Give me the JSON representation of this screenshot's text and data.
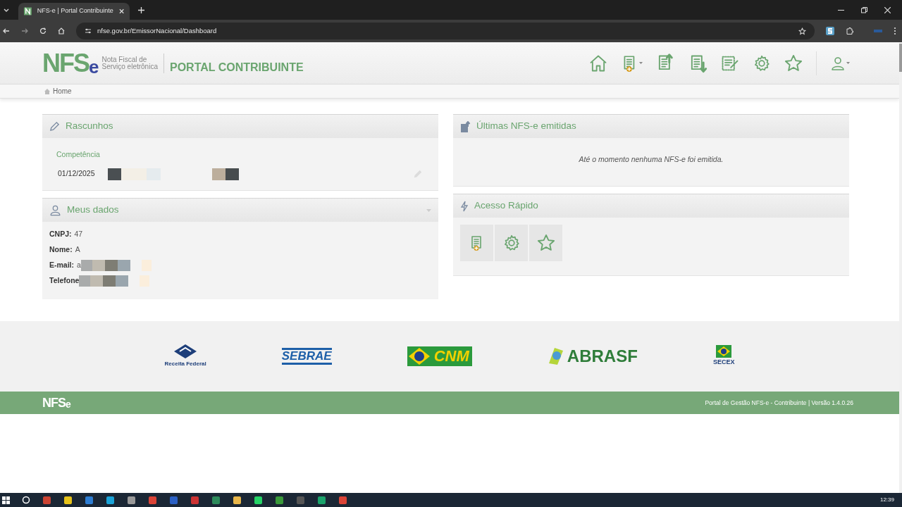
{
  "browser": {
    "tab_title": "NFS-e | Portal Contribuinte",
    "url": "nfse.gov.br/EmissorNacional/Dashboard"
  },
  "header": {
    "logo": {
      "mark": "NFS",
      "mark_e": "e",
      "line1": "Nota Fiscal de",
      "line2": "Serviço eletrônica"
    },
    "portal_title": "PORTAL CONTRIBUINTE"
  },
  "breadcrumb": [
    "Home"
  ],
  "drafts": {
    "title": "Rascunhos",
    "column_1": "Competência",
    "rows": [
      {
        "date": "01/12/2025"
      }
    ]
  },
  "my_data": {
    "title": "Meus dados",
    "fields": [
      {
        "label": "CNPJ:",
        "value": "47",
        "redacted": false
      },
      {
        "label": "Nome:",
        "value": "A",
        "redacted": false
      },
      {
        "label": "E-mail:",
        "value": "a",
        "redacted": true
      },
      {
        "label": "Telefone",
        "redacted": true
      }
    ]
  },
  "latest": {
    "title": "Últimas NFS-e emitidas",
    "message": "Até o momento nenhuma NFS-e foi emitida."
  },
  "quick_access": {
    "title": "Acesso Rápido"
  },
  "partners": [
    {
      "kind": "receita",
      "text": "Receita Federal"
    },
    {
      "kind": "sebrae",
      "text": "SEBRAE"
    },
    {
      "kind": "cnm",
      "text": "CNM"
    },
    {
      "kind": "abrasf",
      "text": "ABRASF"
    },
    {
      "kind": "secex",
      "text": "SECEX"
    }
  ],
  "footer": {
    "logo": "NFS",
    "logo_e": "e",
    "version": "Portal de Gestão NFS-e - Contribuinte | Versão 1.4.0.26"
  },
  "taskbar": {
    "clock": "12:39"
  }
}
